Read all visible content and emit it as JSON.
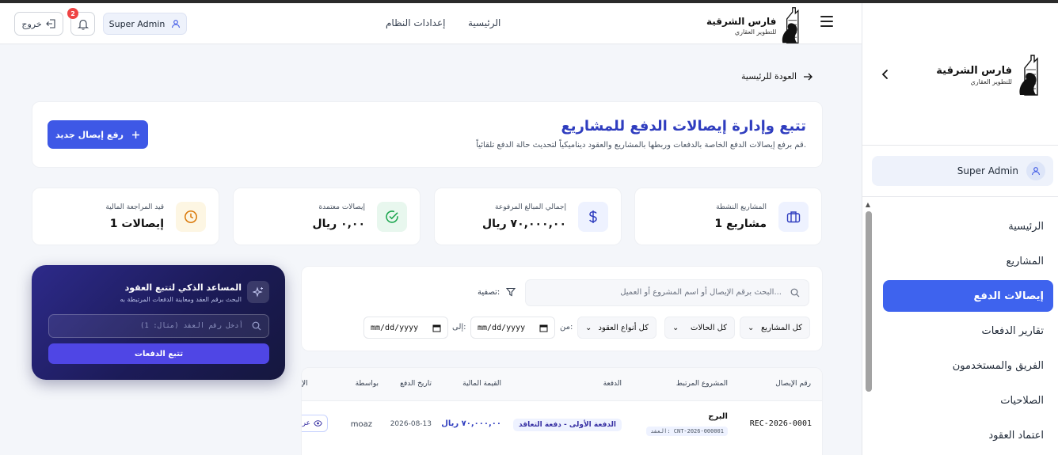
{
  "brand": {
    "name": "فارس الشرقية",
    "tagline": "للتطوير العقاري"
  },
  "header": {
    "nav": {
      "home": "الرئيسية",
      "settings": "إعدادات النظام"
    },
    "logout": "خروج",
    "notifications_count": "2",
    "user": "Super Admin"
  },
  "sidebar": {
    "user": "Super Admin",
    "items": [
      {
        "label": "الرئيسية"
      },
      {
        "label": "المشاريع"
      },
      {
        "label": "إيصالات الدفع"
      },
      {
        "label": "تقارير الدفعات"
      },
      {
        "label": "الفريق والمستخدمون"
      },
      {
        "label": "الصلاحيات"
      },
      {
        "label": "اعتماد العقود"
      }
    ],
    "active_index": 2
  },
  "page": {
    "back_link": "العودة للرئيسية",
    "title": "تتبع وإدارة إيصالات الدفع للمشاريع",
    "subtitle": "قم برفع إيصالات الدفع الخاصة بالدفعات وربطها بالمشاريع والعقود ديناميكياً لتحديث حالة الدفع تلقائياً.",
    "upload_button": "رفع إيصال جديد"
  },
  "stats": [
    {
      "label": "المشاريع النشطة",
      "value": "1 مشاريع",
      "icon": "briefcase-icon",
      "color": "#2f3dbf",
      "bg": "#eef2ff"
    },
    {
      "label": "إجمالي المبالغ المرفوعة",
      "value": "٧٠,٠٠٠,٠٠ ريال",
      "icon": "dollar-icon",
      "color": "#2f3dbf",
      "bg": "#eef2ff"
    },
    {
      "label": "إيصالات معتمدة",
      "value": "٠,٠٠ ريال",
      "icon": "check-circle-icon",
      "color": "#16a34a",
      "bg": "#e8f7ee"
    },
    {
      "label": "قيد المراجعة المالية",
      "value": "1 إيصالات",
      "icon": "clock-icon",
      "color": "#d97706",
      "bg": "#fdf6e3"
    }
  ],
  "filters": {
    "search_placeholder": "البحث برقم الإيصال أو اسم المشروع أو العميل...",
    "filter_label": "تصفية:",
    "projects": "كل المشاريع",
    "statuses": "كل الحالات",
    "contract_types": "كل أنواع العقود",
    "from_label": "من:",
    "to_label": "إلى:",
    "from_date": "mm/dd/yyyy",
    "to_date": "mm/dd/yyyy"
  },
  "assistant": {
    "title": "المساعد الذكي لتتبع العقود",
    "subtitle": "البحث برقم العقد ومعاينة الدفعات المرتبطة به",
    "input_placeholder": "أدخل رقم العقد (مثال: 1)",
    "button": "تتبع الدفعات"
  },
  "table": {
    "columns": [
      "رقم الإيصال",
      "المشروع المرتبط",
      "الدفعة",
      "القيمة المالية",
      "تاريخ الدفع",
      "بواسطة",
      "الإ"
    ],
    "rows": [
      {
        "receipt": "REC-2026-0001",
        "project": "البرج",
        "contract": "العقد: CNT-2026-000001",
        "payment": "الدفعة الأولى - دفعة التعاقد",
        "amount": "٧٠,٠٠٠,٠٠ ريال",
        "date": "2026-08-13",
        "by": "moaz",
        "action": "عرض"
      }
    ]
  }
}
